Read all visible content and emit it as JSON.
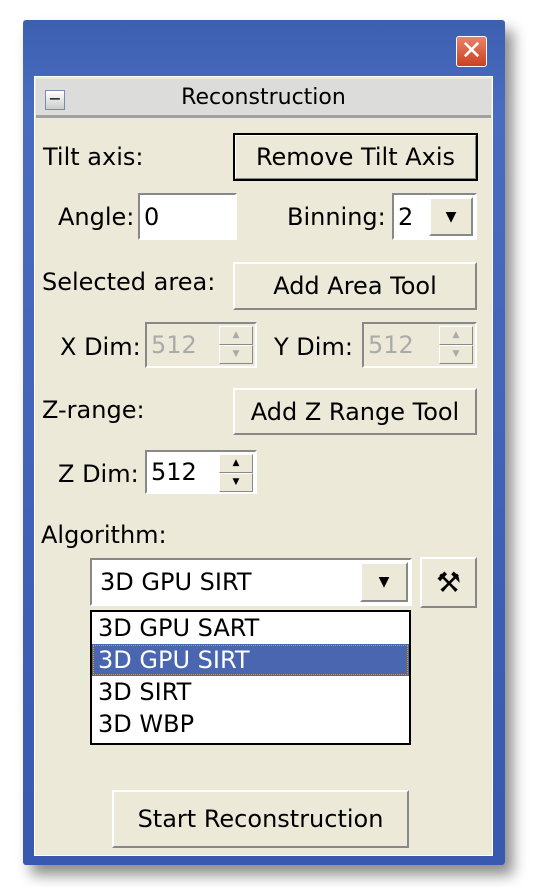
{
  "window": {
    "close_icon": "close-icon",
    "title": "Reconstruction"
  },
  "tilt": {
    "label": "Tilt axis:",
    "button": "Remove Tilt Axis",
    "angle_label": "Angle:",
    "angle_value": "0",
    "binning_label": "Binning:",
    "binning_value": "2"
  },
  "area": {
    "label": "Selected area:",
    "button": "Add Area Tool",
    "x_label": "X Dim:",
    "x_value": "512",
    "y_label": "Y Dim:",
    "y_value": "512"
  },
  "z": {
    "label": "Z-range:",
    "button": "Add Z Range Tool",
    "z_label": "Z Dim:",
    "z_value": "512"
  },
  "algorithm": {
    "label": "Algorithm:",
    "selected": "3D GPU SIRT",
    "options": [
      "3D GPU SART",
      "3D GPU SIRT",
      "3D SIRT",
      "3D WBP"
    ],
    "highlight_color": "#4A66B0"
  },
  "start_button": "Start Reconstruction"
}
